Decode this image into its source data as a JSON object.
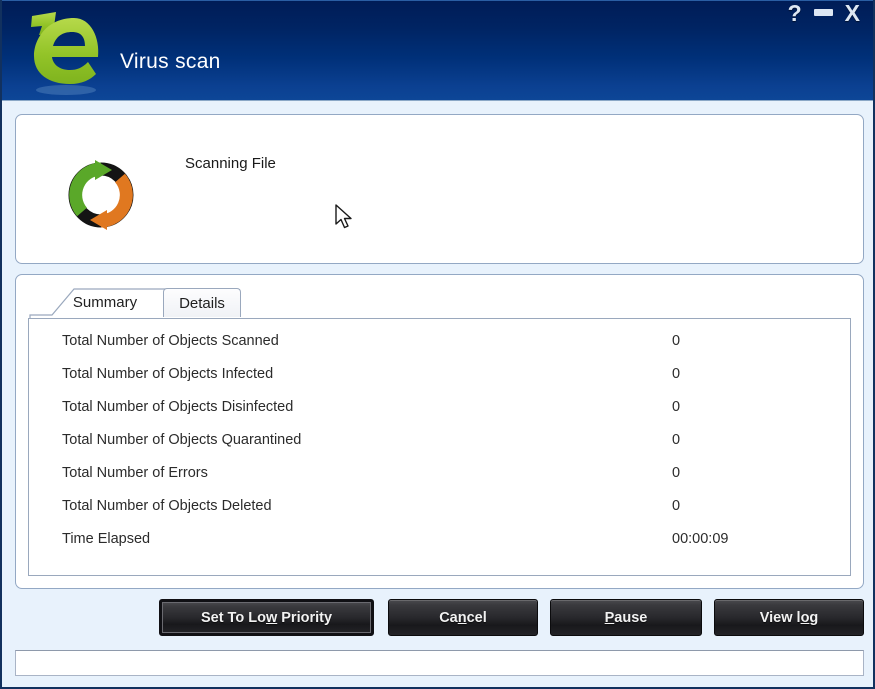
{
  "window": {
    "title": "Virus scan",
    "logo_icon": "escan-e-logo",
    "controls": [
      {
        "name": "help-button",
        "glyph": "?",
        "label": "?"
      },
      {
        "name": "minimize-button",
        "glyph": "—",
        "label": ""
      },
      {
        "name": "close-button",
        "glyph": "X",
        "label": "X"
      }
    ]
  },
  "scan_panel": {
    "status_text": "Scanning File",
    "spinner_icon": "scanning-spinner-icon"
  },
  "tabs": [
    {
      "label": "Summary",
      "active": true
    },
    {
      "label": "Details",
      "active": false
    }
  ],
  "summary": {
    "rows": [
      {
        "label": "Total Number of Objects Scanned",
        "value": "0"
      },
      {
        "label": "Total Number of Objects Infected",
        "value": "0"
      },
      {
        "label": "Total Number of Objects Disinfected",
        "value": "0"
      },
      {
        "label": "Total Number of Objects Quarantined",
        "value": "0"
      },
      {
        "label": "Total Number of Errors",
        "value": "0"
      },
      {
        "label": "Total Number of Objects Deleted",
        "value": "0"
      },
      {
        "label": "Time Elapsed",
        "value": "00:00:09"
      }
    ]
  },
  "buttons": [
    {
      "name": "set-to-low-priority-button",
      "text_before": "Set To Lo",
      "accel": "w",
      "text_after": " Priority",
      "focused": true
    },
    {
      "name": "cancel-button",
      "text_before": "Ca",
      "accel": "n",
      "text_after": "cel",
      "focused": false
    },
    {
      "name": "pause-button",
      "text_before": "",
      "accel": "P",
      "text_after": "ause",
      "focused": false
    },
    {
      "name": "view-log-button",
      "text_before": "View l",
      "accel": "o",
      "text_after": "g",
      "focused": false
    }
  ],
  "statusbar": {
    "text": ""
  },
  "colors": {
    "titlebar_top": "#001c56",
    "titlebar_bottom": "#0d4697",
    "body_background": "#e8f2fc",
    "panel_background": "#ffffff",
    "panel_border": "#93a8c4",
    "button_face": "#28282c",
    "logo_green": "#8cc63f",
    "spinner_green": "#5aa829",
    "spinner_orange": "#e07820",
    "spinner_dark": "#121212"
  }
}
